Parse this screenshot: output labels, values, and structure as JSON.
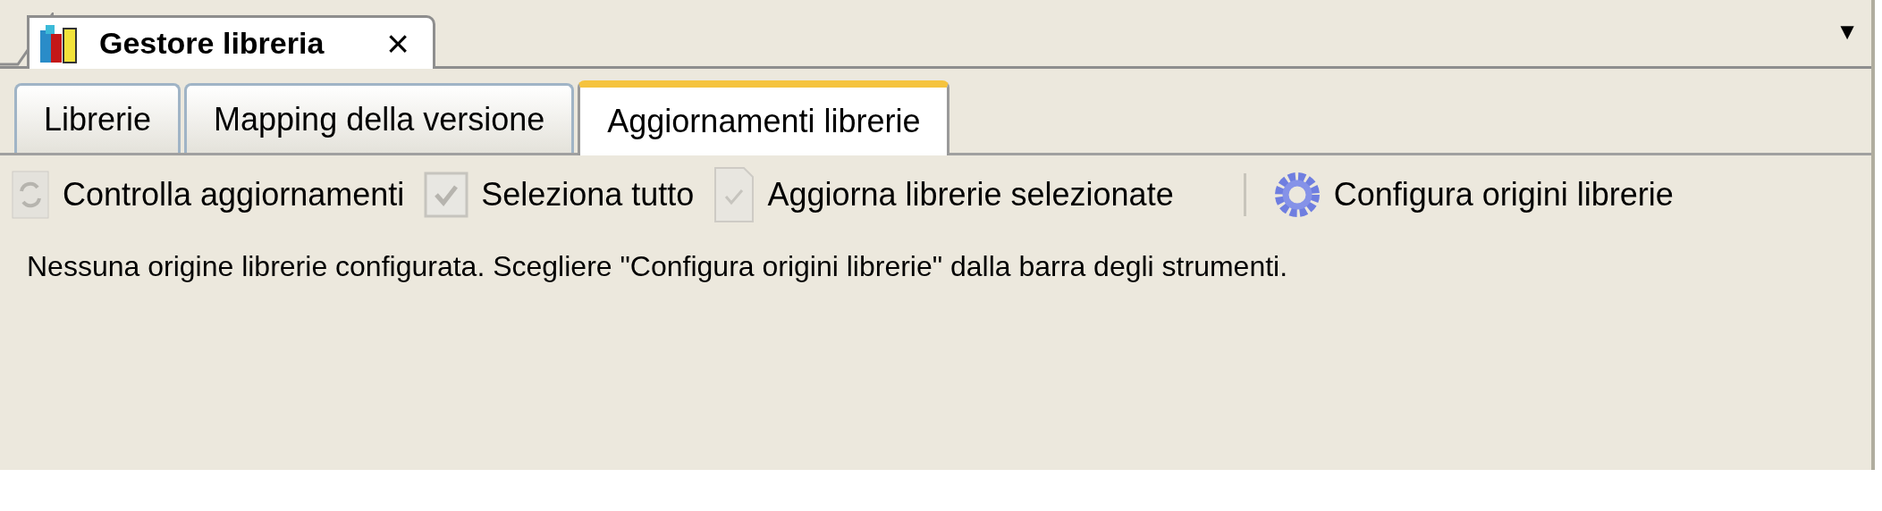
{
  "document_tab": {
    "title": "Gestore libreria",
    "close": "×"
  },
  "menu_arrow": "▼",
  "tabs": [
    {
      "label": "Librerie",
      "selected": false
    },
    {
      "label": "Mapping della versione",
      "selected": false
    },
    {
      "label": "Aggiornamenti librerie",
      "selected": true
    }
  ],
  "toolbar": [
    {
      "kind": "refresh",
      "label": "Controlla aggiornamenti",
      "disabled": true
    },
    {
      "kind": "check",
      "label": "Seleziona tutto",
      "disabled": true
    },
    {
      "kind": "document",
      "label": "Aggiorna librerie selezionate",
      "disabled": true
    },
    {
      "kind": "separator"
    },
    {
      "kind": "gear",
      "label": "Configura origini librerie",
      "disabled": false
    }
  ],
  "message": "Nessuna origine librerie configurata. Scegliere \"Configura origini librerie\" dalla barra degli strumenti."
}
